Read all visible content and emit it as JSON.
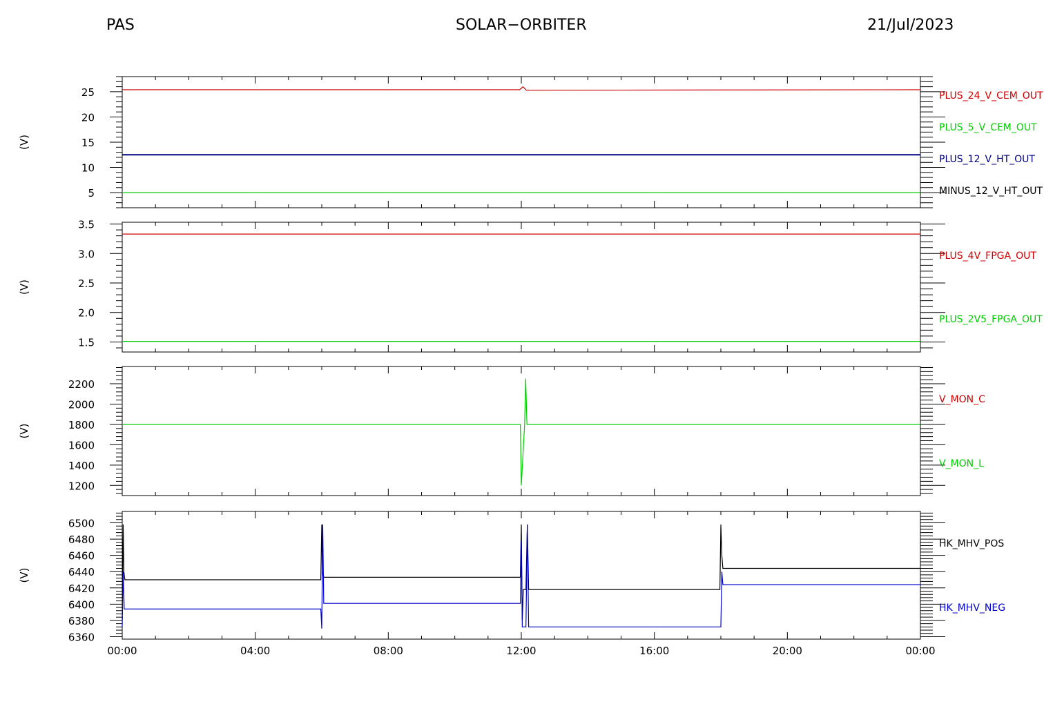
{
  "header": {
    "left": "PAS",
    "center": "SOLAR−ORBITER",
    "right": "21/Jul/2023"
  },
  "chart_data": [
    {
      "type": "line",
      "ylabel": "(V)",
      "ylim": [
        2,
        28
      ],
      "yticks": [
        5,
        10,
        15,
        20,
        25
      ],
      "ytick_labels": [
        "5",
        "10",
        "15",
        "20",
        "25"
      ],
      "series": [
        {
          "name": "PLUS_24_V_CEM_OUT",
          "color": "#cc0000",
          "x": [
            0,
            11.95,
            12.05,
            12.15,
            24
          ],
          "y": [
            25.4,
            25.4,
            26.0,
            25.3,
            25.4
          ]
        },
        {
          "name": "PLUS_5_V_CEM_OUT",
          "color": "#00cc00",
          "x": [
            0,
            24
          ],
          "y": [
            5.0,
            5.0
          ]
        },
        {
          "name": "PLUS_12_V_HT_OUT",
          "color": "#000080",
          "x": [
            0,
            24
          ],
          "y": [
            12.5,
            12.5
          ]
        },
        {
          "name": "MINUS_12_V_HT_OUT",
          "color": "#000000",
          "x": [],
          "y": []
        }
      ]
    },
    {
      "type": "line",
      "ylabel": "(V)",
      "ylim": [
        1.33,
        3.53
      ],
      "yticks": [
        1.5,
        2.0,
        2.5,
        3.0,
        3.5
      ],
      "ytick_labels": [
        "1.5",
        "2.0",
        "2.5",
        "3.0",
        "3.5"
      ],
      "series": [
        {
          "name": "PLUS_4V_FPGA_OUT",
          "color": "#cc0000",
          "x": [
            0,
            24
          ],
          "y": [
            3.33,
            3.33
          ]
        },
        {
          "name": "PLUS_2V5_FPGA_OUT",
          "color": "#00cc00",
          "x": [
            0,
            24
          ],
          "y": [
            1.51,
            1.51
          ]
        }
      ]
    },
    {
      "type": "line",
      "ylabel": "(V)",
      "ylim": [
        1100,
        2370
      ],
      "yticks": [
        1200,
        1400,
        1600,
        1800,
        2000,
        2200
      ],
      "ytick_labels": [
        "1200",
        "1400",
        "1600",
        "1800",
        "2000",
        "2200"
      ],
      "series": [
        {
          "name": "V_MON_C",
          "color": "#cc0000",
          "x": [],
          "y": []
        },
        {
          "name": "V_MON_L",
          "color": "#00cc00",
          "x": [
            0,
            11.97,
            12.0,
            12.05,
            12.1,
            12.13,
            12.17,
            12.2,
            24
          ],
          "y": [
            1800,
            1800,
            1200,
            1500,
            1800,
            2250,
            1800,
            1800,
            1800
          ]
        }
      ]
    },
    {
      "type": "line",
      "ylabel": "(V)",
      "ylim": [
        6357,
        6514
      ],
      "yticks": [
        6360,
        6380,
        6400,
        6420,
        6440,
        6460,
        6480,
        6500
      ],
      "ytick_labels": [
        "6360",
        "6380",
        "6400",
        "6420",
        "6440",
        "6460",
        "6480",
        "6500"
      ],
      "xlim": [
        0,
        24
      ],
      "xticks": [
        0,
        4,
        8,
        12,
        16,
        20,
        24
      ],
      "xtick_labels": [
        "00:00",
        "04:00",
        "08:00",
        "12:00",
        "16:00",
        "20:00",
        "00:00"
      ],
      "series": [
        {
          "name": "HK_MHV_POS",
          "color": "#000000",
          "x": [
            0,
            0.03,
            0.05,
            0.08,
            5.97,
            6.0,
            6.02,
            6.06,
            11.97,
            12.0,
            12.03,
            12.06,
            12.14,
            12.18,
            12.22,
            17.97,
            18.0,
            18.03,
            18.06,
            24
          ],
          "y": [
            6380,
            6498,
            6440,
            6430,
            6430,
            6498,
            6440,
            6433,
            6433,
            6498,
            6380,
            6418,
            6418,
            6498,
            6418,
            6418,
            6498,
            6460,
            6444,
            6444
          ]
        },
        {
          "name": "HK_MHV_NEG",
          "color": "#0000cc",
          "x": [
            0,
            0.03,
            0.06,
            5.97,
            6.0,
            6.03,
            6.06,
            11.97,
            12.0,
            12.03,
            12.06,
            12.14,
            12.18,
            12.22,
            17.97,
            18.0,
            18.03,
            18.06,
            24
          ],
          "y": [
            6372,
            6440,
            6394,
            6394,
            6370,
            6498,
            6401,
            6401,
            6478,
            6372,
            6372,
            6372,
            6498,
            6372,
            6372,
            6372,
            6440,
            6424,
            6424
          ]
        }
      ]
    }
  ]
}
